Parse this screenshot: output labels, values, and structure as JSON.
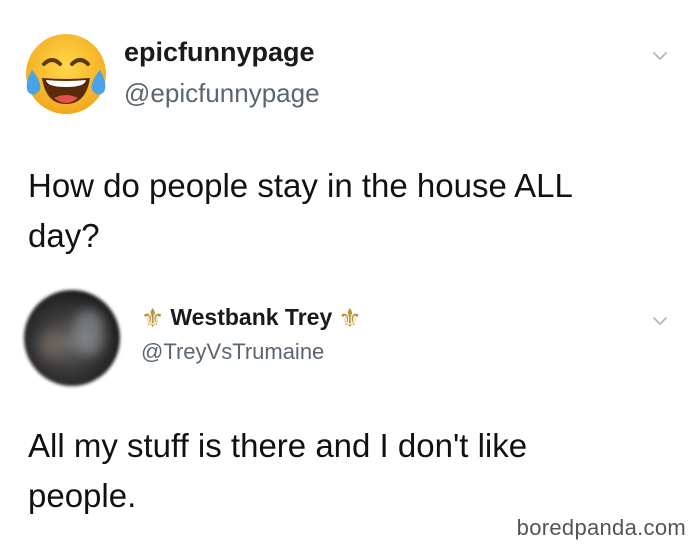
{
  "tweets": [
    {
      "avatar": "laughing-crying-emoji",
      "display_name": "epicfunnypage",
      "handle": "@epicfunnypage",
      "text_line1": "How do people stay in the house ALL",
      "text_line2": "day?",
      "menu_icon": "chevron-down-icon"
    },
    {
      "avatar": "blurred-profile-photo",
      "display_name": "Westbank Trey",
      "name_decoration": "⚜",
      "handle": "@TreyVsTrumaine",
      "text_line1": "All my stuff is there and I don't like",
      "text_line2": "people.",
      "menu_icon": "chevron-down-icon"
    }
  ],
  "watermark": "boredpanda.com",
  "colors": {
    "handle": "#5b6670",
    "fleur": "#b8932e",
    "emoji": "#f7b731"
  }
}
